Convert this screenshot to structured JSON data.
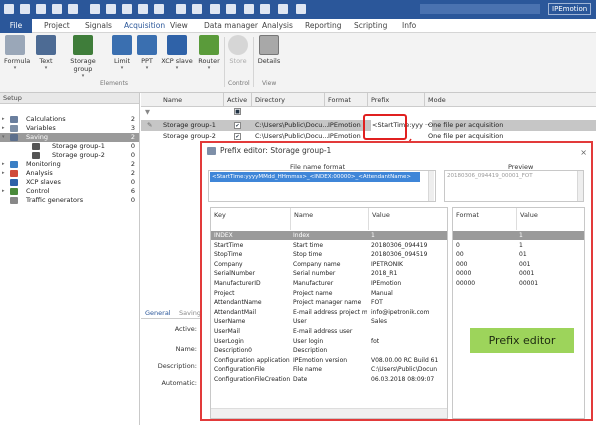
{
  "titlebar": {
    "brand": "IPEmotion"
  },
  "menu": [
    "File",
    "Project",
    "Signals",
    "Acquisition",
    "View",
    "Data manager",
    "Analysis",
    "Reporting",
    "Scripting",
    "Info"
  ],
  "ribbon": {
    "buttons": [
      {
        "label": "Formula",
        "icon": "formula-icon",
        "color": "#9aa7b8"
      },
      {
        "label": "Text",
        "icon": "text-icon",
        "color": "#4d6b94"
      },
      {
        "label": "Storage group",
        "icon": "storage-group-icon",
        "color": "#3f7d3a"
      },
      {
        "label": "Limit",
        "icon": "limit-icon",
        "color": "#3a6fb0"
      },
      {
        "label": "PPT",
        "icon": "ppt-icon",
        "color": "#3a6fb0"
      },
      {
        "label": "XCP slave",
        "icon": "xcp-slave-icon",
        "color": "#2f62a8"
      },
      {
        "label": "Router",
        "icon": "router-icon",
        "color": "#5a9b3a"
      },
      {
        "label": "Store",
        "icon": "store-icon",
        "color": "#c8c8c8"
      },
      {
        "label": "Details",
        "icon": "details-icon",
        "color": "#8c8c8c"
      }
    ],
    "groups": [
      "Elements",
      "Control",
      "View"
    ]
  },
  "setup": {
    "header": "Setup",
    "items": [
      {
        "label": "Calculations",
        "count": "2",
        "expander": "▸",
        "icon": "calculations-icon",
        "color": "#6a7f9e"
      },
      {
        "label": "Variables",
        "count": "3",
        "expander": "▸",
        "icon": "variables-icon",
        "color": "#7d8fa6"
      },
      {
        "label": "Saving",
        "count": "2",
        "expander": "▾",
        "icon": "saving-icon",
        "color": "#5c6f8c",
        "selected": true
      },
      {
        "label": "Storage group-1",
        "count": "0",
        "expander": "",
        "icon": "storage-group-icon",
        "color": "#555",
        "indent": true
      },
      {
        "label": "Storage group-2",
        "count": "0",
        "expander": "",
        "icon": "storage-group-icon",
        "color": "#555",
        "indent": true
      },
      {
        "label": "Monitoring",
        "count": "2",
        "expander": "▸",
        "icon": "monitoring-icon",
        "color": "#3a7fc4"
      },
      {
        "label": "Analysis",
        "count": "2",
        "expander": "▸",
        "icon": "analysis-icon",
        "color": "#d04a3a"
      },
      {
        "label": "XCP slaves",
        "count": "0",
        "expander": "",
        "icon": "xcp-slave-icon",
        "color": "#2f62a8"
      },
      {
        "label": "Control",
        "count": "6",
        "expander": "▸",
        "icon": "control-icon",
        "color": "#4a8a3a"
      },
      {
        "label": "Traffic generators",
        "count": "0",
        "expander": "",
        "icon": "traffic-generator-icon",
        "color": "#888"
      }
    ]
  },
  "grid": {
    "columns": [
      "Name",
      "Active",
      "Directory",
      "Format",
      "Prefix",
      "Mode"
    ],
    "rows": [
      {
        "name": "Storage group-1",
        "active": "✔",
        "directory": "C:\\Users\\Public\\Docu...",
        "format": "IPEmotion",
        "prefix": "<StartTime:yyy ···",
        "mode": "One file per acquisition",
        "selected": true
      },
      {
        "name": "Storage group-2",
        "active": "✔",
        "directory": "C:\\Users\\Public\\Docu...",
        "format": "IPEmotion",
        "prefix": "",
        "mode": "One file per acquisition",
        "selected": false
      }
    ]
  },
  "props": {
    "tabs": [
      "General",
      "Saving"
    ],
    "labels": [
      "Active:",
      "Name:",
      "Description:",
      "Automatic:"
    ]
  },
  "dialog": {
    "title": "Prefix editor: Storage group-1",
    "file_name_format_label": "File name format",
    "file_name_format": "<StartTime:yyyyMMdd_HHmmss>_<INDEX:00000>_<AttendantName>",
    "preview_label": "Preview",
    "preview": "20180306_094419_00001_FOT",
    "key_columns": [
      "Key",
      "Name",
      "Value"
    ],
    "format_columns": [
      "Format",
      "Value"
    ],
    "rows": [
      {
        "key": "INDEX",
        "name": "Index",
        "value": "1",
        "format": "",
        "fvalue": "1",
        "selected": true
      },
      {
        "key": "StartTime",
        "name": "Start time",
        "value": "20180306_094419",
        "format": "0",
        "fvalue": "1"
      },
      {
        "key": "StopTime",
        "name": "Stop time",
        "value": "20180306_094519",
        "format": "00",
        "fvalue": "01"
      },
      {
        "key": "Company",
        "name": "Company name",
        "value": "IPETRONIK",
        "format": "000",
        "fvalue": "001"
      },
      {
        "key": "SerialNumber",
        "name": "Serial number",
        "value": "2018_R1",
        "format": "0000",
        "fvalue": "0001"
      },
      {
        "key": "ManufacturerID",
        "name": "Manufacturer",
        "value": "IPEmotion",
        "format": "00000",
        "fvalue": "00001"
      },
      {
        "key": "Project",
        "name": "Project name",
        "value": "Manual",
        "format": "",
        "fvalue": ""
      },
      {
        "key": "AttendantName",
        "name": "Project manager name",
        "value": "FOT",
        "format": "",
        "fvalue": ""
      },
      {
        "key": "AttendantMail",
        "name": "E-mail address project mana...",
        "value": "info@ipetronik.com",
        "format": "",
        "fvalue": ""
      },
      {
        "key": "UserName",
        "name": "User",
        "value": "Sales",
        "format": "",
        "fvalue": ""
      },
      {
        "key": "UserMail",
        "name": "E-mail address user",
        "value": "",
        "format": "",
        "fvalue": ""
      },
      {
        "key": "UserLogin",
        "name": "User login",
        "value": "fot",
        "format": "",
        "fvalue": ""
      },
      {
        "key": "Description0",
        "name": "Description",
        "value": "",
        "format": "",
        "fvalue": ""
      },
      {
        "key": "Configuration application",
        "name": "IPEmotion version",
        "value": "V08.00.00 RC Build 61",
        "format": "",
        "fvalue": ""
      },
      {
        "key": "ConfigurationFile",
        "name": "File name",
        "value": "C:\\Users\\Public\\Docun",
        "format": "",
        "fvalue": ""
      },
      {
        "key": "ConfigurationFileCreation",
        "name": "Date",
        "value": "06.03.2018 08:09:07",
        "format": "",
        "fvalue": ""
      }
    ],
    "annotation": "Prefix editor"
  },
  "colors": {
    "accent": "#2b579a",
    "highlight": "#e23a3a",
    "annotation": "#9dd45b",
    "selection": "#9a9a9a"
  }
}
